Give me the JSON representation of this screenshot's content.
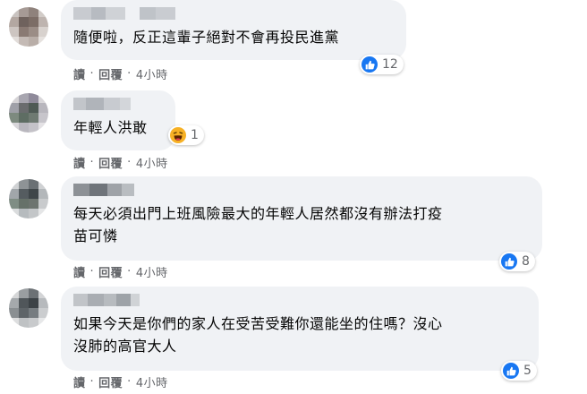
{
  "comments": [
    {
      "text": "隨便啦，反正這輩子絕對不會再投民進黨",
      "reaction": {
        "type": "like",
        "icon": "like-icon",
        "count": "12"
      },
      "actions": {
        "read": "讀",
        "reply": "回覆",
        "time": "4小時"
      }
    },
    {
      "text": "年輕人洪敢",
      "reaction": {
        "type": "haha",
        "icon": "haha-icon",
        "count": "1"
      },
      "actions": {
        "read": "讀",
        "reply": "回覆",
        "time": "4小時"
      }
    },
    {
      "text": "每天必須出門上班風險最大的年輕人居然都沒有辦法打疫\n苗可憐",
      "reaction": {
        "type": "like",
        "icon": "like-icon",
        "count": "8"
      },
      "actions": {
        "read": "讀",
        "reply": "回覆",
        "time": "4小時"
      }
    },
    {
      "text": "如果今天是你們的家人在受苦受難你還能坐的住嗎？沒心\n沒肺的高官大人",
      "reaction": {
        "type": "like",
        "icon": "like-icon",
        "count": "5"
      },
      "actions": {
        "read": "讀",
        "reply": "回覆",
        "time": "4小時"
      }
    }
  ],
  "colors": {
    "bubble": "#f0f2f5",
    "like_blue": "#1877f2",
    "haha_yellow": "#f7b125",
    "meta_gray": "#65676b"
  }
}
